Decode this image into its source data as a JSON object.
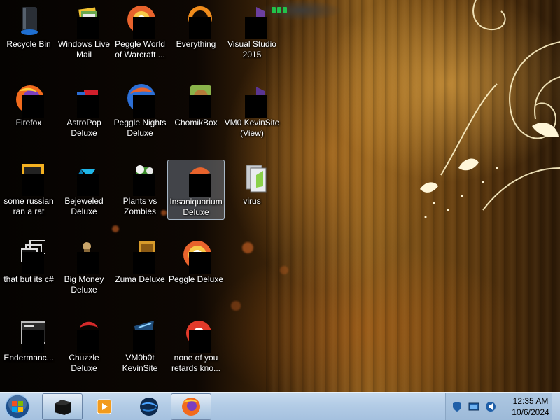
{
  "desktop": {
    "icons": [
      {
        "label": "Recycle Bin",
        "icon": "recycle-bin-icon"
      },
      {
        "label": "Windows Live Mail",
        "icon": "windows-live-mail-icon"
      },
      {
        "label": "Peggle World of Warcraft ...",
        "icon": "peggle-wow-icon"
      },
      {
        "label": "Everything",
        "icon": "everything-search-icon"
      },
      {
        "label": "Visual Studio 2015",
        "icon": "visual-studio-icon"
      },
      {
        "label": "Firefox",
        "icon": "firefox-icon"
      },
      {
        "label": "AstroPop Deluxe",
        "icon": "astropop-icon"
      },
      {
        "label": "Peggle Nights Deluxe",
        "icon": "peggle-nights-icon"
      },
      {
        "label": "ChomikBox",
        "icon": "chomikbox-icon"
      },
      {
        "label": "VM0 KevinSite (View)",
        "icon": "vm0-kevinsite-view-icon"
      },
      {
        "label": "some russian ran a rat",
        "icon": "exe-file-icon"
      },
      {
        "label": "Bejeweled Deluxe",
        "icon": "bejeweled-icon"
      },
      {
        "label": "Plants vs Zombies",
        "icon": "plants-vs-zombies-icon"
      },
      {
        "label": "Insaniquarium Deluxe",
        "icon": "insaniquarium-icon"
      },
      {
        "label": "virus",
        "icon": "folder-icon"
      },
      {
        "label": "that but its c#",
        "icon": "shortcut-stack-icon"
      },
      {
        "label": "Big Money Deluxe",
        "icon": "big-money-icon"
      },
      {
        "label": "Zuma Deluxe",
        "icon": "zuma-icon"
      },
      {
        "label": "Peggle Deluxe",
        "icon": "peggle-icon"
      },
      {
        "label": "Endermanc...",
        "icon": "console-app-icon"
      },
      {
        "label": "Chuzzle Deluxe",
        "icon": "chuzzle-icon"
      },
      {
        "label": "VM0b0t KevinSite",
        "icon": "vm0b0t-icon"
      },
      {
        "label": "none of you retards kno...",
        "icon": "red-app-icon"
      }
    ]
  },
  "taskbar": {
    "start_icon": "windows-start-orb-icon",
    "buttons": [
      {
        "icon": "terminal-app-icon",
        "active": true
      },
      {
        "icon": "media-player-icon",
        "active": false
      },
      {
        "icon": "globe-app-icon",
        "active": false
      },
      {
        "icon": "firefox-icon",
        "active": true
      }
    ],
    "tray_icons": [
      "shield-tray-icon",
      "network-tray-icon",
      "volume-tray-icon"
    ],
    "clock": {
      "time": "12:35 AM",
      "date": "10/6/2024"
    }
  },
  "colors": {
    "taskbar": "#b3cce6",
    "selection": "#b4c8dc",
    "wallpaper_gold": "#8a5c1c"
  }
}
